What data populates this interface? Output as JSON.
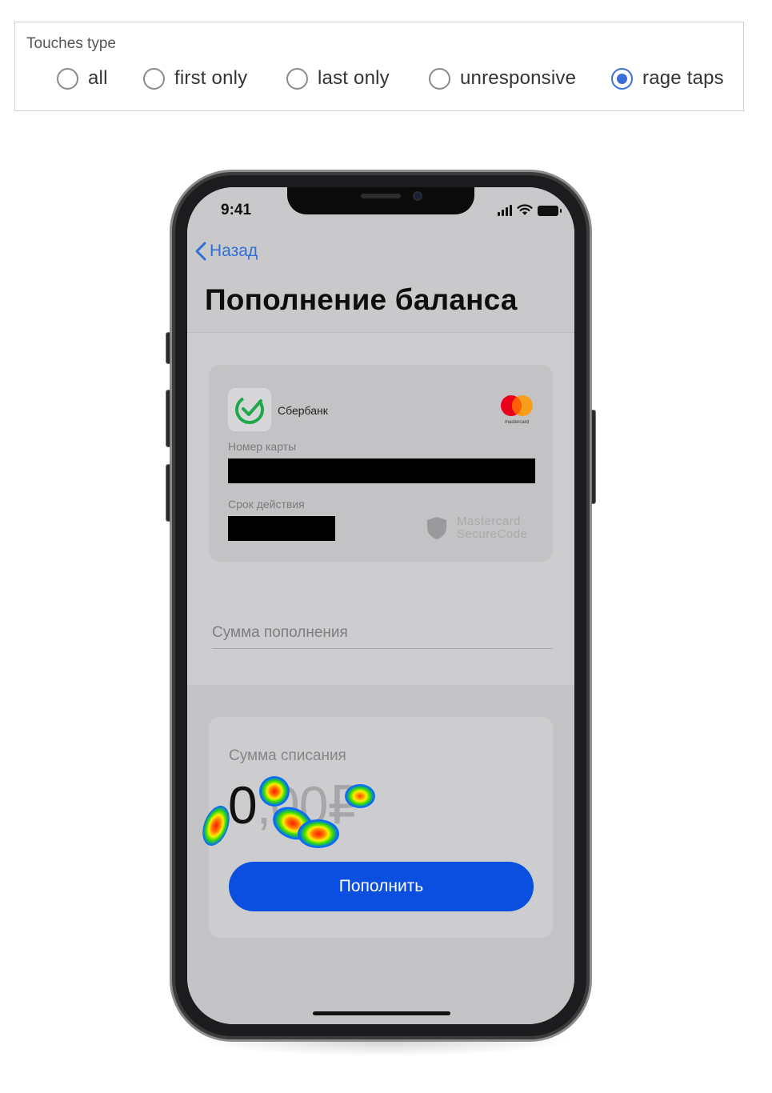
{
  "filter": {
    "title": "Touches type",
    "options": [
      {
        "label": "all",
        "checked": false
      },
      {
        "label": "first only",
        "checked": false
      },
      {
        "label": "last only",
        "checked": false
      },
      {
        "label": "unresponsive",
        "checked": false
      },
      {
        "label": "rage taps",
        "checked": true
      }
    ],
    "accent_color": "#3a6fd9"
  },
  "phone": {
    "status_bar": {
      "time": "9:41"
    },
    "nav": {
      "back_label": "Назад"
    },
    "page_title": "Пополнение баланса",
    "card": {
      "bank_name": "Сбербанк",
      "brand_small": "mastercard",
      "card_number_label": "Номер карты",
      "expiry_label": "Срок действия",
      "secure_line1": "Mastercard",
      "secure_line2": "SecureCode"
    },
    "amount_input": {
      "placeholder": "Сумма пополнения"
    },
    "debit": {
      "label": "Сумма списания",
      "whole": "0",
      "decimals": ",00₽"
    },
    "submit_button": {
      "label": "Пополнить",
      "color": "#0b4fe0"
    }
  }
}
